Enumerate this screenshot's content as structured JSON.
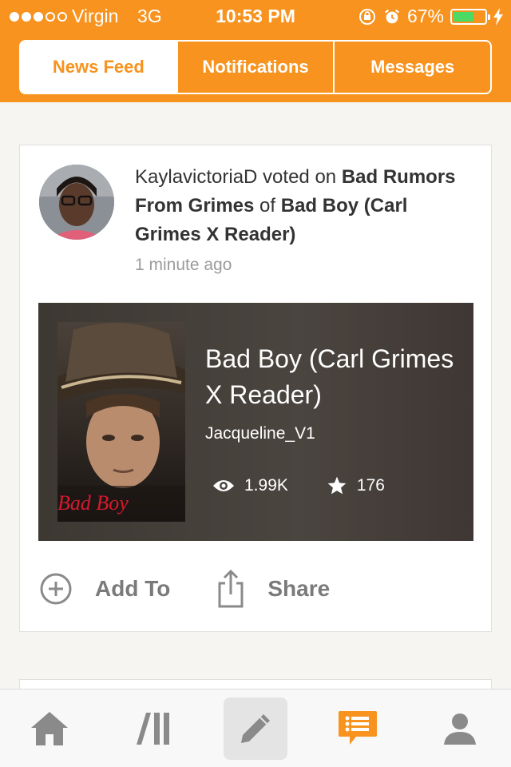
{
  "status": {
    "carrier": "Virgin",
    "network": "3G",
    "time": "10:53 PM",
    "battery": "67%",
    "battery_level": 0.67,
    "signal_bars": 3
  },
  "tabs": [
    {
      "label": "News Feed",
      "active": true
    },
    {
      "label": "Notifications",
      "active": false
    },
    {
      "label": "Messages",
      "active": false
    }
  ],
  "feed": {
    "user": "KaylavictoriaD",
    "verb": " voted on ",
    "part": "Bad Rumors From Grimes",
    "of": " of ",
    "story": "Bad Boy (Carl Grimes X Reader)",
    "time": "1 minute ago",
    "card": {
      "title": "Bad Boy (Carl Grimes X Reader)",
      "author": "Jacqueline_V1",
      "reads": "1.99K",
      "votes": "176",
      "cover_text": "Bad Boy"
    },
    "actions": {
      "add": "Add To",
      "share": "Share"
    }
  },
  "tabbar": [
    "home-icon",
    "library-icon",
    "write-icon",
    "messages-icon",
    "profile-icon"
  ],
  "colors": {
    "brand": "#f7931e",
    "icon_gray": "#8a8a8a"
  }
}
